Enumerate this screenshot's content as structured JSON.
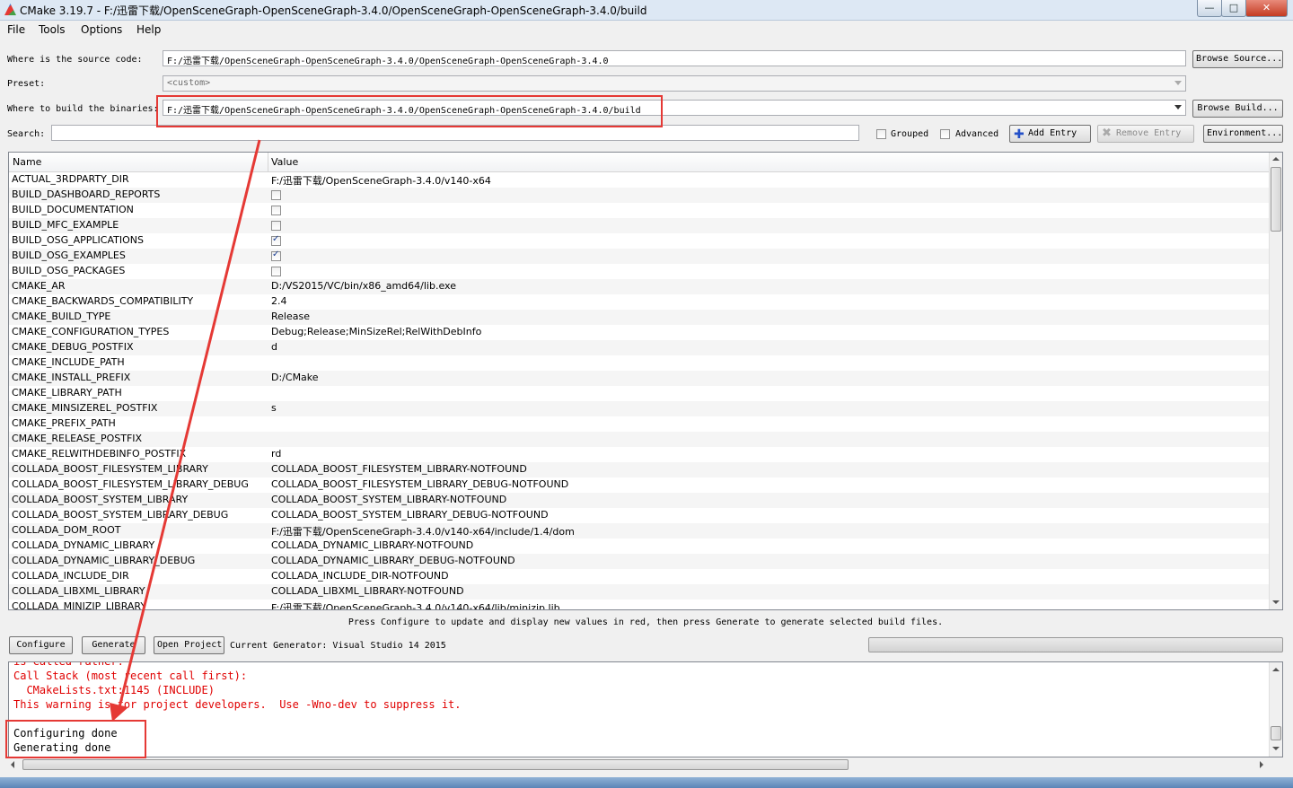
{
  "window": {
    "title": "CMake 3.19.7 - F:/迅雷下载/OpenSceneGraph-OpenSceneGraph-3.4.0/OpenSceneGraph-OpenSceneGraph-3.4.0/build",
    "minimize": "—",
    "maximize": "□",
    "close": "✕"
  },
  "menu": [
    "File",
    "Tools",
    "Options",
    "Help"
  ],
  "source": {
    "label": "Where is the source code:",
    "value": "F:/迅雷下载/OpenSceneGraph-OpenSceneGraph-3.4.0/OpenSceneGraph-OpenSceneGraph-3.4.0",
    "button": "Browse Source..."
  },
  "preset": {
    "label": "Preset:",
    "value": "<custom>"
  },
  "binaries": {
    "label": "Where to build the binaries:",
    "value": "F:/迅雷下载/OpenSceneGraph-OpenSceneGraph-3.4.0/OpenSceneGraph-OpenSceneGraph-3.4.0/build",
    "button": "Browse Build..."
  },
  "search": {
    "label": "Search:",
    "value": "",
    "grouped": "Grouped",
    "advanced": "Advanced",
    "add_entry": "Add Entry",
    "remove_entry": "Remove Entry",
    "environment": "Environment..."
  },
  "table": {
    "headers": {
      "name": "Name",
      "value": "Value"
    },
    "rows": [
      {
        "name": "ACTUAL_3RDPARTY_DIR",
        "value": "F:/迅雷下载/OpenSceneGraph-3.4.0/v140-x64"
      },
      {
        "name": "BUILD_DASHBOARD_REPORTS",
        "value": "",
        "check": false
      },
      {
        "name": "BUILD_DOCUMENTATION",
        "value": "",
        "check": false
      },
      {
        "name": "BUILD_MFC_EXAMPLE",
        "value": "",
        "check": false
      },
      {
        "name": "BUILD_OSG_APPLICATIONS",
        "value": "",
        "check": true
      },
      {
        "name": "BUILD_OSG_EXAMPLES",
        "value": "",
        "check": true
      },
      {
        "name": "BUILD_OSG_PACKAGES",
        "value": "",
        "check": false
      },
      {
        "name": "CMAKE_AR",
        "value": "D:/VS2015/VC/bin/x86_amd64/lib.exe"
      },
      {
        "name": "CMAKE_BACKWARDS_COMPATIBILITY",
        "value": "2.4"
      },
      {
        "name": "CMAKE_BUILD_TYPE",
        "value": "Release"
      },
      {
        "name": "CMAKE_CONFIGURATION_TYPES",
        "value": "Debug;Release;MinSizeRel;RelWithDebInfo"
      },
      {
        "name": "CMAKE_DEBUG_POSTFIX",
        "value": "d"
      },
      {
        "name": "CMAKE_INCLUDE_PATH",
        "value": ""
      },
      {
        "name": "CMAKE_INSTALL_PREFIX",
        "value": "D:/CMake"
      },
      {
        "name": "CMAKE_LIBRARY_PATH",
        "value": ""
      },
      {
        "name": "CMAKE_MINSIZEREL_POSTFIX",
        "value": "s"
      },
      {
        "name": "CMAKE_PREFIX_PATH",
        "value": ""
      },
      {
        "name": "CMAKE_RELEASE_POSTFIX",
        "value": ""
      },
      {
        "name": "CMAKE_RELWITHDEBINFO_POSTFIX",
        "value": "rd"
      },
      {
        "name": "COLLADA_BOOST_FILESYSTEM_LIBRARY",
        "value": "COLLADA_BOOST_FILESYSTEM_LIBRARY-NOTFOUND"
      },
      {
        "name": "COLLADA_BOOST_FILESYSTEM_LIBRARY_DEBUG",
        "value": "COLLADA_BOOST_FILESYSTEM_LIBRARY_DEBUG-NOTFOUND"
      },
      {
        "name": "COLLADA_BOOST_SYSTEM_LIBRARY",
        "value": "COLLADA_BOOST_SYSTEM_LIBRARY-NOTFOUND"
      },
      {
        "name": "COLLADA_BOOST_SYSTEM_LIBRARY_DEBUG",
        "value": "COLLADA_BOOST_SYSTEM_LIBRARY_DEBUG-NOTFOUND"
      },
      {
        "name": "COLLADA_DOM_ROOT",
        "value": "F:/迅雷下载/OpenSceneGraph-3.4.0/v140-x64/include/1.4/dom"
      },
      {
        "name": "COLLADA_DYNAMIC_LIBRARY",
        "value": "COLLADA_DYNAMIC_LIBRARY-NOTFOUND"
      },
      {
        "name": "COLLADA_DYNAMIC_LIBRARY_DEBUG",
        "value": "COLLADA_DYNAMIC_LIBRARY_DEBUG-NOTFOUND"
      },
      {
        "name": "COLLADA_INCLUDE_DIR",
        "value": "COLLADA_INCLUDE_DIR-NOTFOUND"
      },
      {
        "name": "COLLADA_LIBXML_LIBRARY",
        "value": "COLLADA_LIBXML_LIBRARY-NOTFOUND"
      },
      {
        "name": "COLLADA_MINIZIP_LIBRARY",
        "value": "F:/迅雷下载/OpenSceneGraph-3.4.0/v140-x64/lib/minizip.lib"
      }
    ]
  },
  "hint": "Press Configure to update and display new values in red,  then press Generate to generate selected build files.",
  "actions": {
    "configure": "Configure",
    "generate": "Generate",
    "open_project": "Open Project",
    "generator": "Current Generator: Visual Studio 14 2015"
  },
  "output": [
    {
      "text": "Call Stack (most recent call first):",
      "error": true
    },
    {
      "text": "  CMakeLists.txt:1145 (INCLUDE)",
      "error": true
    },
    {
      "text": "This warning is for project developers.  Use -Wno-dev to suppress it.",
      "error": true
    },
    {
      "text": "",
      "error": false
    },
    {
      "text": "Configuring done",
      "error": false
    },
    {
      "text": "Generating done",
      "error": false
    }
  ],
  "colors": {
    "annotation": "#e53935",
    "error_text": "#e00000"
  }
}
